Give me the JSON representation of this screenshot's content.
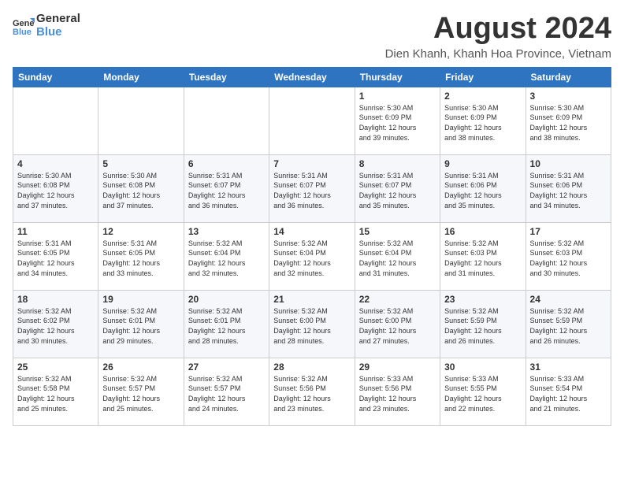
{
  "logo": {
    "general": "General",
    "blue": "Blue"
  },
  "calendar": {
    "title": "August 2024",
    "subtitle": "Dien Khanh, Khanh Hoa Province, Vietnam"
  },
  "weekdays": [
    "Sunday",
    "Monday",
    "Tuesday",
    "Wednesday",
    "Thursday",
    "Friday",
    "Saturday"
  ],
  "weeks": [
    [
      {
        "day": "",
        "info": ""
      },
      {
        "day": "",
        "info": ""
      },
      {
        "day": "",
        "info": ""
      },
      {
        "day": "",
        "info": ""
      },
      {
        "day": "1",
        "info": "Sunrise: 5:30 AM\nSunset: 6:09 PM\nDaylight: 12 hours\nand 39 minutes."
      },
      {
        "day": "2",
        "info": "Sunrise: 5:30 AM\nSunset: 6:09 PM\nDaylight: 12 hours\nand 38 minutes."
      },
      {
        "day": "3",
        "info": "Sunrise: 5:30 AM\nSunset: 6:09 PM\nDaylight: 12 hours\nand 38 minutes."
      }
    ],
    [
      {
        "day": "4",
        "info": "Sunrise: 5:30 AM\nSunset: 6:08 PM\nDaylight: 12 hours\nand 37 minutes."
      },
      {
        "day": "5",
        "info": "Sunrise: 5:30 AM\nSunset: 6:08 PM\nDaylight: 12 hours\nand 37 minutes."
      },
      {
        "day": "6",
        "info": "Sunrise: 5:31 AM\nSunset: 6:07 PM\nDaylight: 12 hours\nand 36 minutes."
      },
      {
        "day": "7",
        "info": "Sunrise: 5:31 AM\nSunset: 6:07 PM\nDaylight: 12 hours\nand 36 minutes."
      },
      {
        "day": "8",
        "info": "Sunrise: 5:31 AM\nSunset: 6:07 PM\nDaylight: 12 hours\nand 35 minutes."
      },
      {
        "day": "9",
        "info": "Sunrise: 5:31 AM\nSunset: 6:06 PM\nDaylight: 12 hours\nand 35 minutes."
      },
      {
        "day": "10",
        "info": "Sunrise: 5:31 AM\nSunset: 6:06 PM\nDaylight: 12 hours\nand 34 minutes."
      }
    ],
    [
      {
        "day": "11",
        "info": "Sunrise: 5:31 AM\nSunset: 6:05 PM\nDaylight: 12 hours\nand 34 minutes."
      },
      {
        "day": "12",
        "info": "Sunrise: 5:31 AM\nSunset: 6:05 PM\nDaylight: 12 hours\nand 33 minutes."
      },
      {
        "day": "13",
        "info": "Sunrise: 5:32 AM\nSunset: 6:04 PM\nDaylight: 12 hours\nand 32 minutes."
      },
      {
        "day": "14",
        "info": "Sunrise: 5:32 AM\nSunset: 6:04 PM\nDaylight: 12 hours\nand 32 minutes."
      },
      {
        "day": "15",
        "info": "Sunrise: 5:32 AM\nSunset: 6:04 PM\nDaylight: 12 hours\nand 31 minutes."
      },
      {
        "day": "16",
        "info": "Sunrise: 5:32 AM\nSunset: 6:03 PM\nDaylight: 12 hours\nand 31 minutes."
      },
      {
        "day": "17",
        "info": "Sunrise: 5:32 AM\nSunset: 6:03 PM\nDaylight: 12 hours\nand 30 minutes."
      }
    ],
    [
      {
        "day": "18",
        "info": "Sunrise: 5:32 AM\nSunset: 6:02 PM\nDaylight: 12 hours\nand 30 minutes."
      },
      {
        "day": "19",
        "info": "Sunrise: 5:32 AM\nSunset: 6:01 PM\nDaylight: 12 hours\nand 29 minutes."
      },
      {
        "day": "20",
        "info": "Sunrise: 5:32 AM\nSunset: 6:01 PM\nDaylight: 12 hours\nand 28 minutes."
      },
      {
        "day": "21",
        "info": "Sunrise: 5:32 AM\nSunset: 6:00 PM\nDaylight: 12 hours\nand 28 minutes."
      },
      {
        "day": "22",
        "info": "Sunrise: 5:32 AM\nSunset: 6:00 PM\nDaylight: 12 hours\nand 27 minutes."
      },
      {
        "day": "23",
        "info": "Sunrise: 5:32 AM\nSunset: 5:59 PM\nDaylight: 12 hours\nand 26 minutes."
      },
      {
        "day": "24",
        "info": "Sunrise: 5:32 AM\nSunset: 5:59 PM\nDaylight: 12 hours\nand 26 minutes."
      }
    ],
    [
      {
        "day": "25",
        "info": "Sunrise: 5:32 AM\nSunset: 5:58 PM\nDaylight: 12 hours\nand 25 minutes."
      },
      {
        "day": "26",
        "info": "Sunrise: 5:32 AM\nSunset: 5:57 PM\nDaylight: 12 hours\nand 25 minutes."
      },
      {
        "day": "27",
        "info": "Sunrise: 5:32 AM\nSunset: 5:57 PM\nDaylight: 12 hours\nand 24 minutes."
      },
      {
        "day": "28",
        "info": "Sunrise: 5:32 AM\nSunset: 5:56 PM\nDaylight: 12 hours\nand 23 minutes."
      },
      {
        "day": "29",
        "info": "Sunrise: 5:33 AM\nSunset: 5:56 PM\nDaylight: 12 hours\nand 23 minutes."
      },
      {
        "day": "30",
        "info": "Sunrise: 5:33 AM\nSunset: 5:55 PM\nDaylight: 12 hours\nand 22 minutes."
      },
      {
        "day": "31",
        "info": "Sunrise: 5:33 AM\nSunset: 5:54 PM\nDaylight: 12 hours\nand 21 minutes."
      }
    ]
  ]
}
